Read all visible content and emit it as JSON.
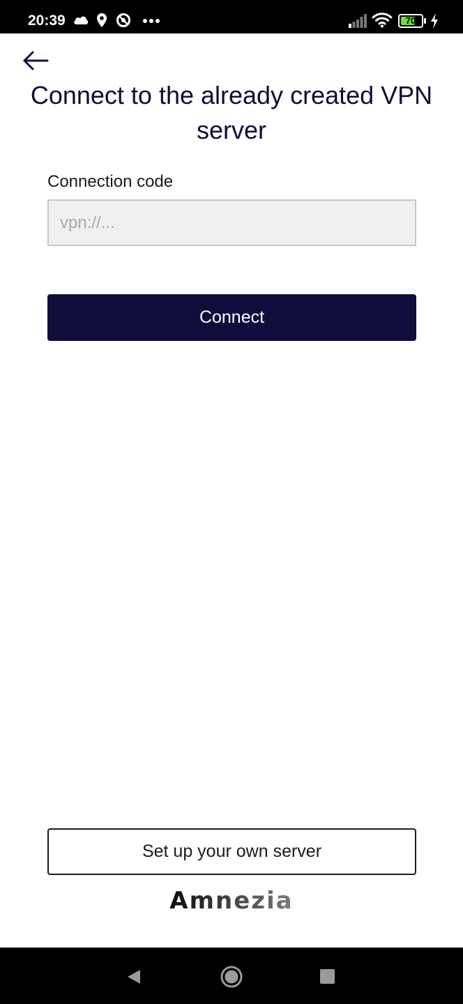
{
  "status_bar": {
    "time": "20:39",
    "icons": [
      "cloud-icon",
      "location-icon",
      "do-not-disturb-icon",
      "more-dots-icon",
      "signal-icon",
      "wifi-icon",
      "battery-icon",
      "charging-icon"
    ],
    "battery_level": "70",
    "battery_fraction": 0.7
  },
  "header": {
    "back_icon": "arrow-left-icon",
    "title": "Connect to the already created VPN server"
  },
  "form": {
    "label": "Connection code",
    "input_value": "",
    "input_placeholder": "vpn://...",
    "connect_label": "Connect"
  },
  "footer": {
    "setup_label": "Set up your own server",
    "logo_text": "Amnezia"
  },
  "nav_bar": {
    "items": [
      "back-icon",
      "home-icon",
      "recents-icon"
    ]
  },
  "colors": {
    "primary": "#100d3d",
    "title": "#100d35",
    "input_bg": "#f0f0f0",
    "battery": "#6ede2a"
  }
}
